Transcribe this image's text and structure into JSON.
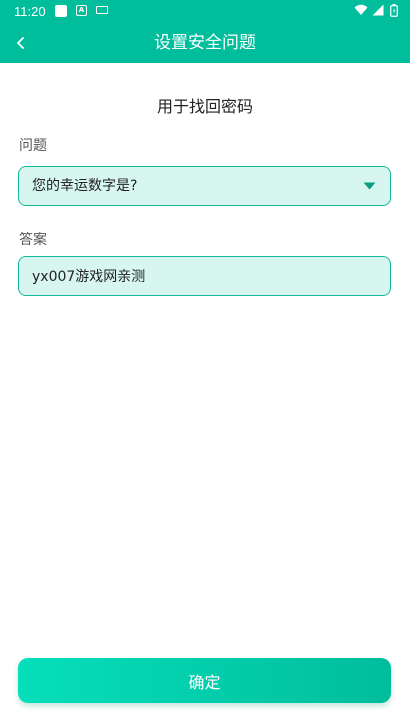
{
  "status_bar": {
    "time": "11:20",
    "badge": "A"
  },
  "header": {
    "title": "设置安全问题"
  },
  "form": {
    "subtitle": "用于找回密码",
    "question_label": "问题",
    "question_value": "您的幸运数字是?",
    "answer_label": "答案",
    "answer_value": "yx007游戏网亲测"
  },
  "confirm_label": "确定",
  "colors": {
    "primary": "#00bd9c",
    "field_bg": "#d7f6f0",
    "field_border": "#16b898"
  }
}
